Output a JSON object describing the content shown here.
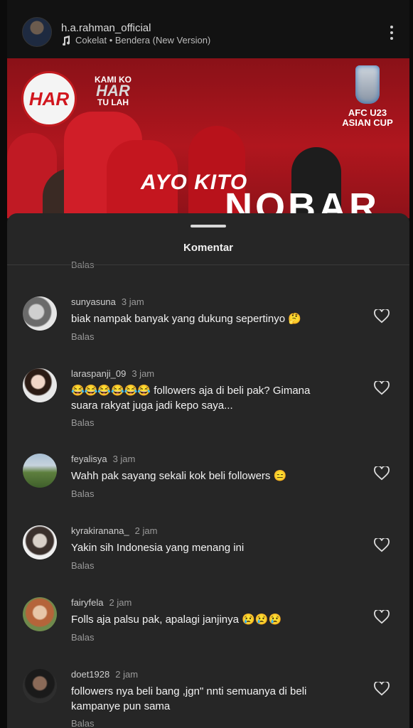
{
  "header": {
    "username": "h.a.rahman_official",
    "music": "Cokelat • Bendera (New Version)"
  },
  "banner": {
    "har_logo": "HAR",
    "kami_top": "KAMI KO",
    "kami_mid": "HAR",
    "kami_bottom": "TU LAH",
    "afc_line1": "AFC U23",
    "afc_line2": "ASIAN CUP",
    "ayo_kito": "AYO KITO",
    "nobar": "NOBAR"
  },
  "sheet": {
    "title": "Komentar",
    "partial_reply": "Balas"
  },
  "comments": [
    {
      "user": "sunyasuna",
      "time": "3 jam",
      "text": "biak nampak banyak yang dukung sepertinyo 🤔",
      "reply": "Balas"
    },
    {
      "user": "laraspanji_09",
      "time": "3 jam",
      "text": "😂😂😂😂😂😂 followers aja di beli pak? Gimana suara rakyat juga jadi kepo saya...",
      "reply": "Balas"
    },
    {
      "user": "feyalisya",
      "time": "3 jam",
      "text": "Wahh pak sayang sekali kok beli followers 😑",
      "reply": "Balas"
    },
    {
      "user": "kyrakiranana_",
      "time": "2 jam",
      "text": "Yakin sih Indonesia yang menang ini",
      "reply": "Balas"
    },
    {
      "user": "fairyfela",
      "time": "2 jam",
      "text": "Folls aja palsu pak, apalagi janjinya 😢😢😢",
      "reply": "Balas"
    },
    {
      "user": "doet1928",
      "time": "2 jam",
      "text": "followers nya beli bang ,jgn\" nnti semuanya di beli kampanye pun sama",
      "reply": "Balas"
    }
  ],
  "colors": {
    "sheet_bg": "#262626",
    "banner_red": "#b0161e",
    "text_primary": "#f2f2f2",
    "text_secondary": "#9a9a9a"
  },
  "icons": [
    "music-note-icon",
    "more-vertical-icon",
    "heart-outline-icon"
  ]
}
